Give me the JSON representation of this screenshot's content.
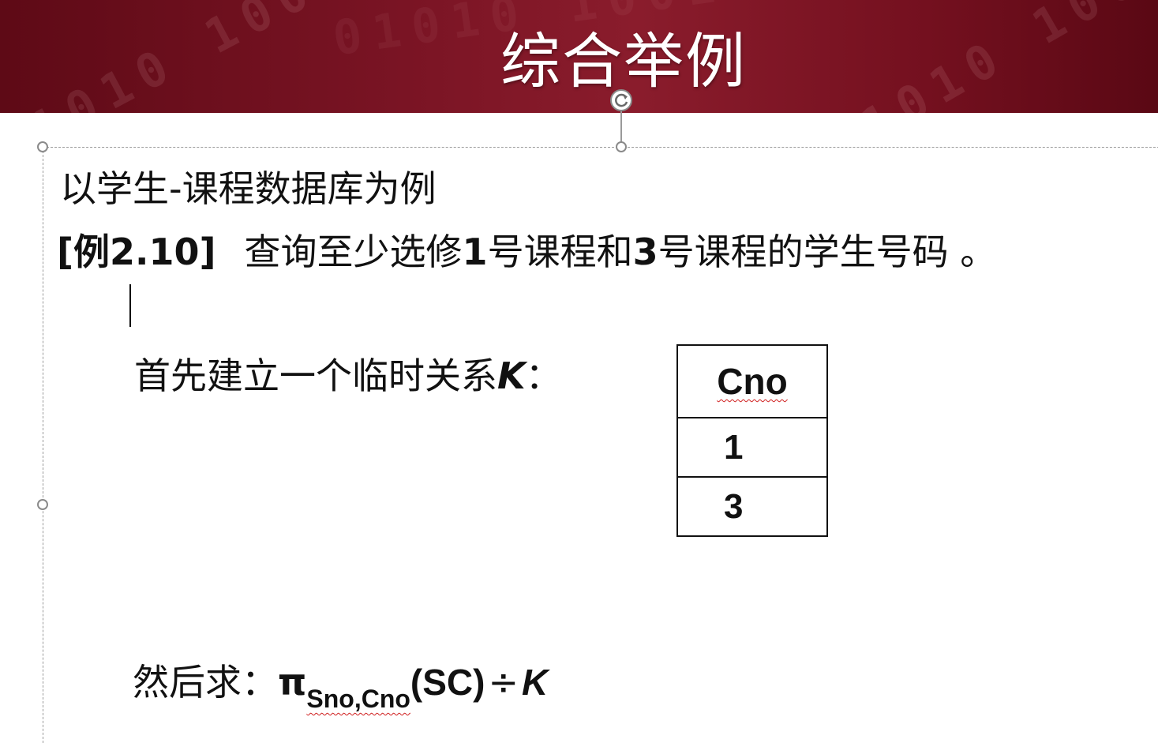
{
  "slide": {
    "title": "综合举例",
    "banner_color": "#7a1424",
    "banner_pattern": "01010 1001",
    "intro_line": "以学生-课程数据库为例",
    "example": {
      "number": "[例2.10]",
      "text_part1": "查询至少选修",
      "num1": "1",
      "text_part2": "号课程和",
      "num2": "3",
      "text_part3": "号课程的学生号码 。"
    },
    "temp_relation": {
      "prefix": "首先建立一个临时关系",
      "name": "K",
      "suffix": "："
    },
    "relation_table": {
      "header": "Cno",
      "rows": [
        "1",
        "3"
      ]
    },
    "formula": {
      "prefix": "然后求：",
      "pi": "π",
      "subscript": "Sno,Cno",
      "operand": "(SC)",
      "operator": "÷",
      "divisor": "K"
    }
  }
}
